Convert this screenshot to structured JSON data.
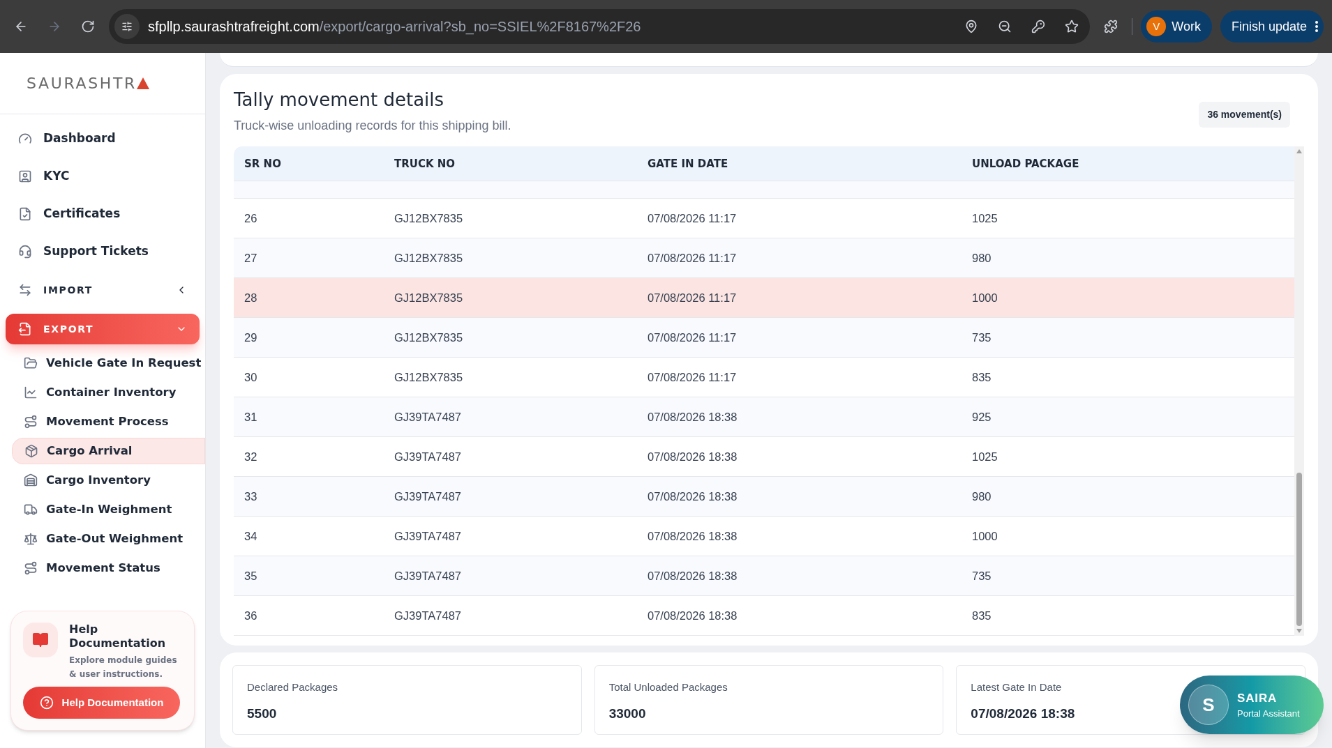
{
  "browser": {
    "url": {
      "host": "sfpllp.saurashtrafreight.com",
      "path": "/export/cargo-arrival?sb_no=SSIEL%2F8167%2F26"
    },
    "profile": {
      "initial": "V",
      "label": "Work"
    },
    "update_button": "Finish update"
  },
  "sidebar": {
    "logo": "SAURASHTR",
    "items": [
      {
        "kind": "item",
        "label": "Dashboard",
        "selected": false
      },
      {
        "kind": "item",
        "label": "KYC",
        "selected": false
      },
      {
        "kind": "item",
        "label": "Certificates",
        "selected": false
      },
      {
        "kind": "item",
        "label": "Support Tickets",
        "selected": false
      },
      {
        "kind": "section",
        "label": "IMPORT",
        "selected": false,
        "expanded": false
      },
      {
        "kind": "section",
        "label": "EXPORT",
        "selected": true,
        "expanded": true,
        "children": [
          {
            "label": "Vehicle Gate In Request",
            "selected": false
          },
          {
            "label": "Container Inventory",
            "selected": false
          },
          {
            "label": "Movement Process",
            "selected": false
          },
          {
            "label": "Cargo Arrival",
            "selected": true
          },
          {
            "label": "Cargo Inventory",
            "selected": false
          },
          {
            "label": "Gate-In Weighment",
            "selected": false
          },
          {
            "label": "Gate-Out Weighment",
            "selected": false
          },
          {
            "label": "Movement Status",
            "selected": false
          }
        ]
      }
    ],
    "help": {
      "title": "Help Documentation",
      "text": "Explore module guides & user instructions.",
      "button": "Help Documentation"
    }
  },
  "tally": {
    "title": "Tally movement details",
    "subtitle": "Truck-wise unloading records for this shipping bill.",
    "count_badge": "36 movement(s)",
    "table": {
      "columns": [
        "SR NO",
        "TRUCK NO",
        "GATE IN DATE",
        "UNLOAD PACKAGE"
      ],
      "rows": [
        {
          "cells": [
            "26",
            "GJ12BX7835",
            "07/08/2026 11:17",
            "1025"
          ],
          "selected": false
        },
        {
          "cells": [
            "27",
            "GJ12BX7835",
            "07/08/2026 11:17",
            "980"
          ],
          "selected": false
        },
        {
          "cells": [
            "28",
            "GJ12BX7835",
            "07/08/2026 11:17",
            "1000"
          ],
          "selected": true
        },
        {
          "cells": [
            "29",
            "GJ12BX7835",
            "07/08/2026 11:17",
            "735"
          ],
          "selected": false
        },
        {
          "cells": [
            "30",
            "GJ12BX7835",
            "07/08/2026 11:17",
            "835"
          ],
          "selected": false
        },
        {
          "cells": [
            "31",
            "GJ39TA7487",
            "07/08/2026 18:38",
            "925"
          ],
          "selected": false
        },
        {
          "cells": [
            "32",
            "GJ39TA7487",
            "07/08/2026 18:38",
            "1025"
          ],
          "selected": false
        },
        {
          "cells": [
            "33",
            "GJ39TA7487",
            "07/08/2026 18:38",
            "980"
          ],
          "selected": false
        },
        {
          "cells": [
            "34",
            "GJ39TA7487",
            "07/08/2026 18:38",
            "1000"
          ],
          "selected": false
        },
        {
          "cells": [
            "35",
            "GJ39TA7487",
            "07/08/2026 18:38",
            "735"
          ],
          "selected": false
        },
        {
          "cells": [
            "36",
            "GJ39TA7487",
            "07/08/2026 18:38",
            "835"
          ],
          "selected": false
        }
      ]
    }
  },
  "summary": [
    {
      "label": "Declared Packages",
      "value": "5500"
    },
    {
      "label": "Total Unloaded Packages",
      "value": "33000"
    },
    {
      "label": "Latest Gate In Date",
      "value": "07/08/2026 18:38"
    }
  ],
  "assistant": {
    "initial": "S",
    "name": "SAIRA",
    "role": "Portal Assistant"
  }
}
